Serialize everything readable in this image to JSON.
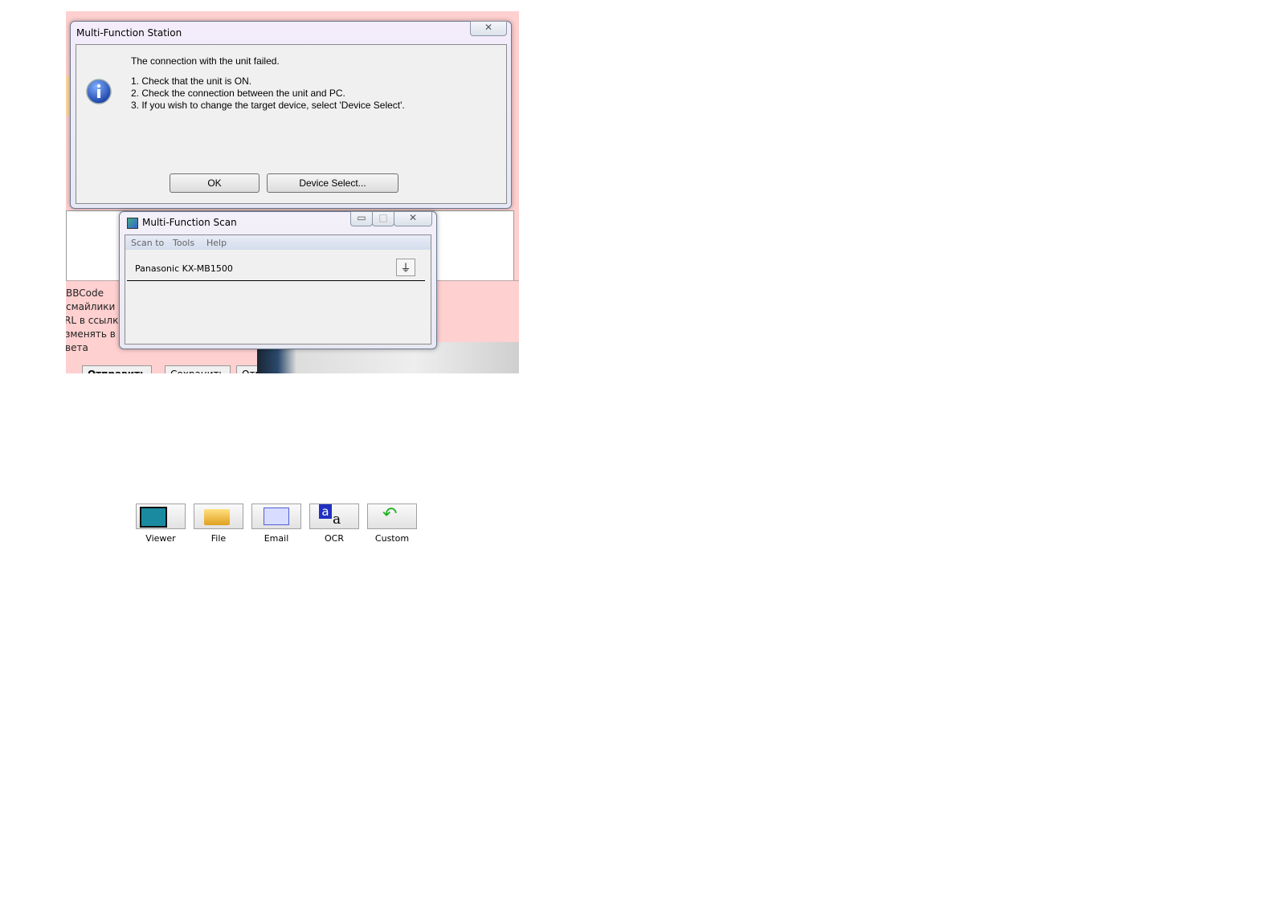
{
  "background": {
    "left_texts": [
      "BBCode",
      "смайлики",
      "RL в ссылки",
      "зменять в",
      "вета"
    ],
    "buttons": [
      "Отправить",
      "Сохранить",
      "Отм"
    ]
  },
  "dialog": {
    "title": "Multi-Function Station",
    "icon": "info-icon",
    "heading": "The connection with the unit failed.",
    "lines": [
      "1. Check that the unit is ON.",
      "2. Check the connection between the unit and PC.",
      "3. If you wish to change the target device, select 'Device Select'."
    ],
    "ok_label": "OK",
    "device_select_label": "Device Select..."
  },
  "scan": {
    "title": "Multi-Function Scan",
    "menu": [
      "Scan to",
      "Tools",
      "Help"
    ],
    "device": "Panasonic KX-MB1500",
    "tools": [
      {
        "label": "Viewer",
        "icon": "viewer-icon"
      },
      {
        "label": "File",
        "icon": "folder-icon"
      },
      {
        "label": "Email",
        "icon": "envelope-icon"
      },
      {
        "label": "OCR",
        "icon": "ocr-icon"
      },
      {
        "label": "Custom",
        "icon": "custom-arrow-icon"
      }
    ]
  }
}
